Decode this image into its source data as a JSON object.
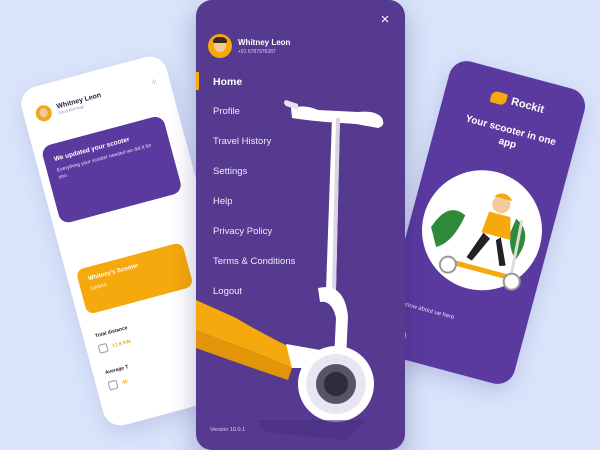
{
  "left_card": {
    "user_name": "Whitney Leon",
    "user_sub": "Good Morning!",
    "notice_title": "We updated your scooter",
    "notice_body": "Everything your scooter needed we did it for you.",
    "scooter_title": "Whitney's Scooter",
    "scooter_status": "Locked",
    "stat_distance_label": "Total distance",
    "stat_distance_value": "17.8 KM",
    "stat_average_label": "Average T",
    "stat_average_value": "40"
  },
  "menu_card": {
    "user_name": "Whitney Leon",
    "user_phone": "+91 6787976287",
    "close_icon": "×",
    "items": [
      {
        "label": "Home",
        "active": true
      },
      {
        "label": "Profile",
        "active": false
      },
      {
        "label": "Travel History",
        "active": false
      },
      {
        "label": "Settings",
        "active": false
      },
      {
        "label": "Help",
        "active": false
      },
      {
        "label": "Privacy Policy",
        "active": false
      },
      {
        "label": "Terms & Conditions",
        "active": false
      },
      {
        "label": "Logout",
        "active": false
      }
    ],
    "version": "Version 10.0.1"
  },
  "right_card": {
    "brand": "Rockit",
    "tagline": "Your scooter in one app",
    "body": "u know about ue here in"
  },
  "colors": {
    "background": "#d9e4fb",
    "purple": "#553a8f",
    "accent": "#f6a90c"
  }
}
